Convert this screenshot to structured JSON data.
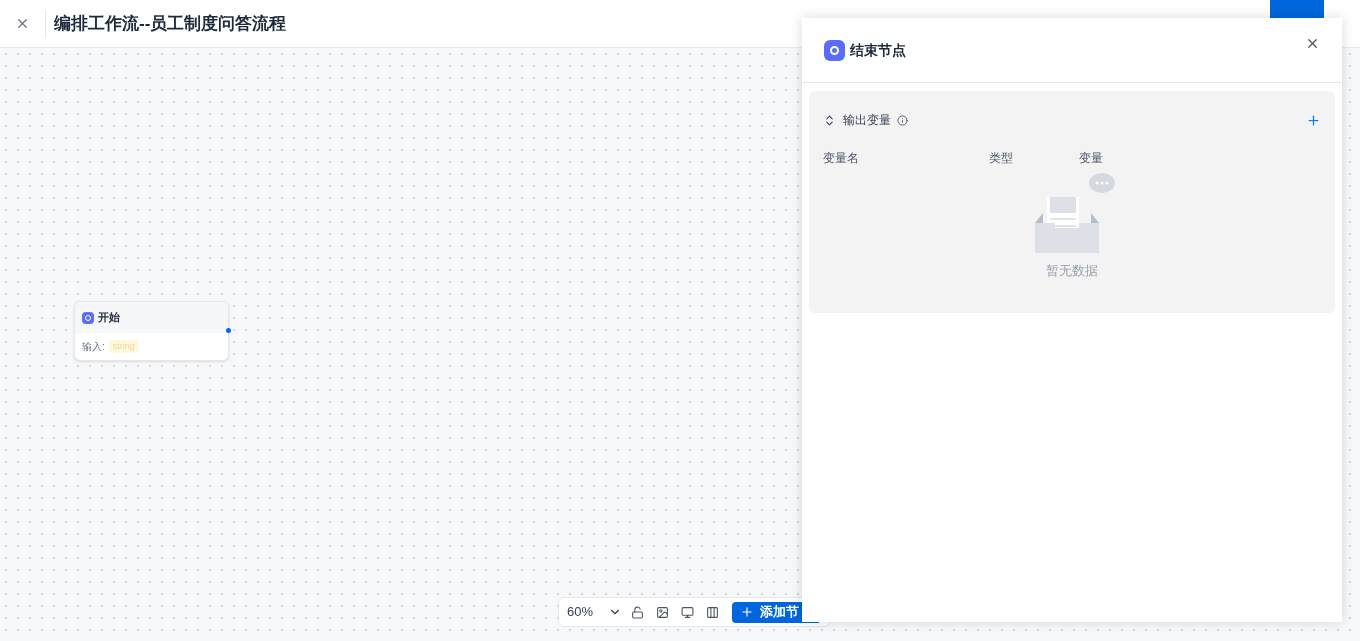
{
  "header": {
    "title": "编排工作流--员工制度问答流程"
  },
  "start_node": {
    "title": "开始",
    "input_label": "输入:",
    "input_type": "string"
  },
  "toolbar": {
    "zoom": "60%",
    "add_button": "添加节"
  },
  "panel": {
    "title": "结束节点",
    "section": {
      "title": "输出变量",
      "expanded": true,
      "columns": [
        "变量名",
        "类型",
        "变量"
      ],
      "empty_text": "暂无数据"
    }
  }
}
